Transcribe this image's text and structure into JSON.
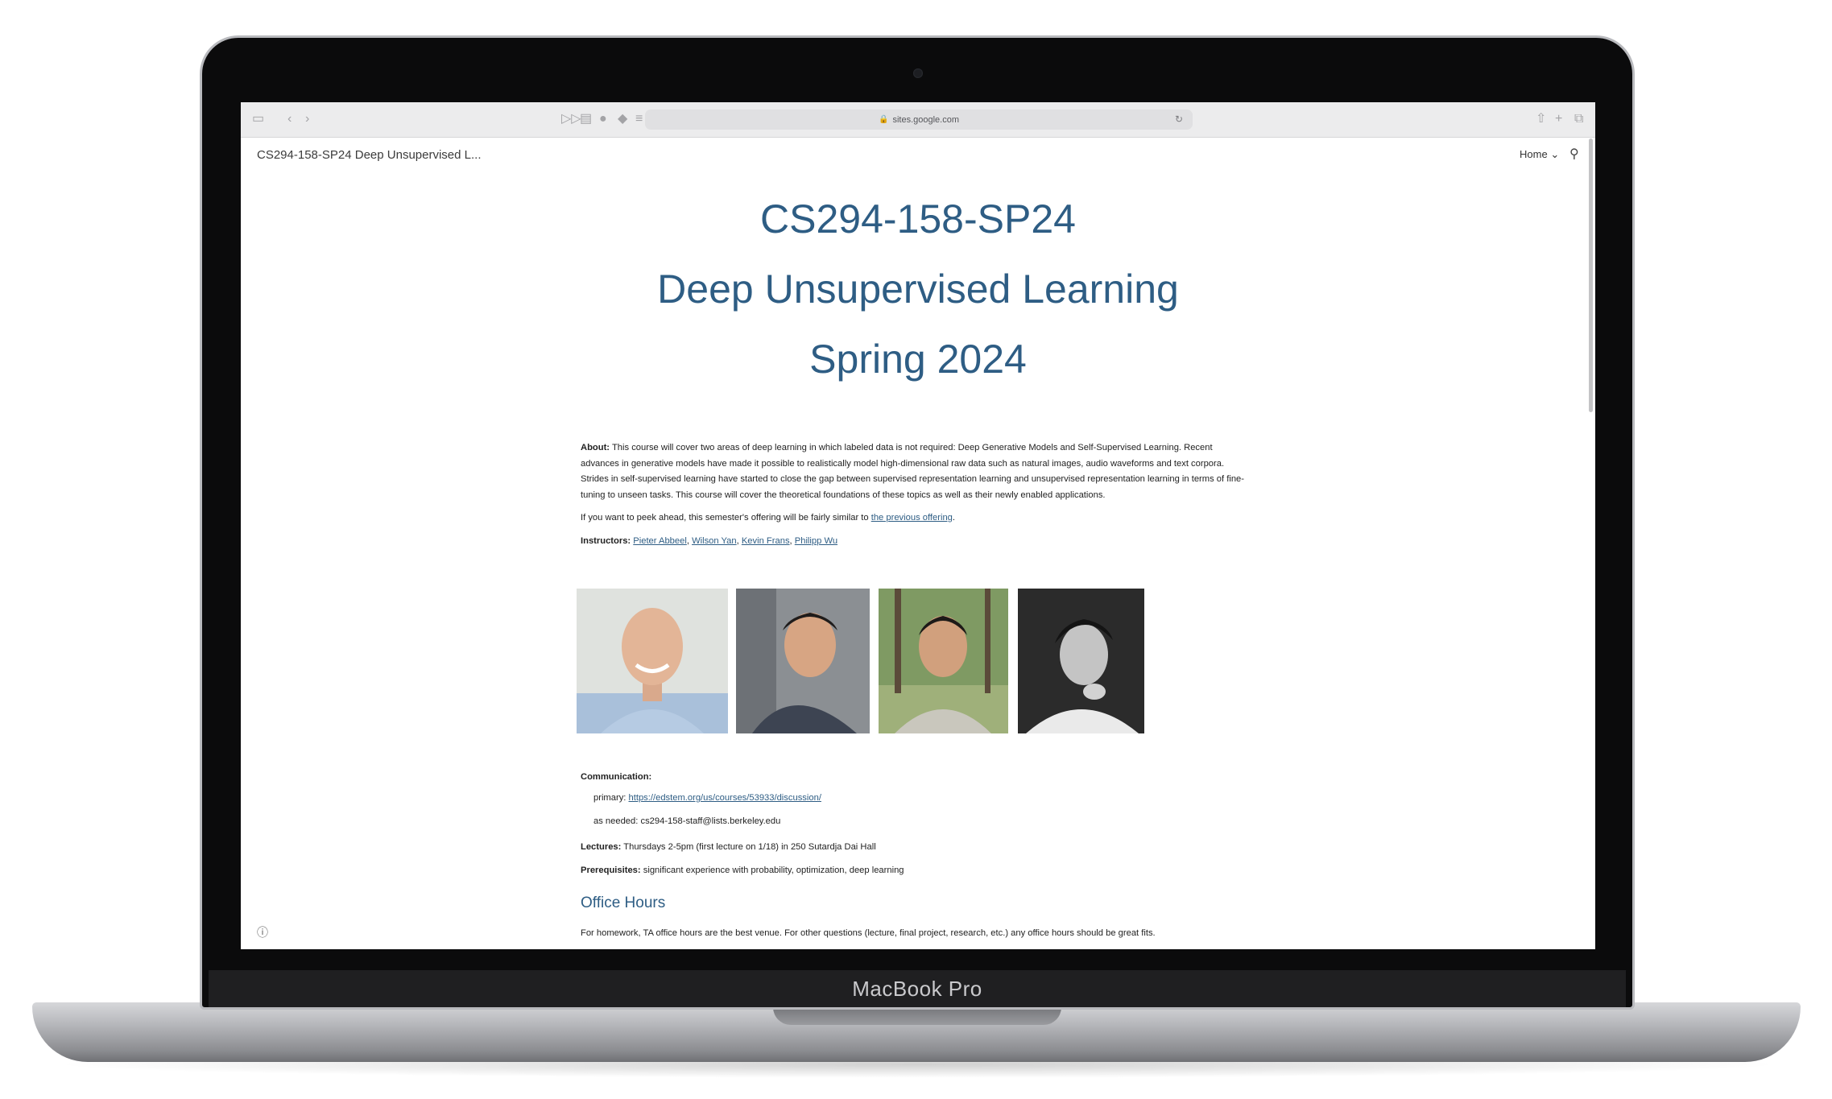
{
  "device": {
    "label": "MacBook Pro"
  },
  "browser": {
    "address": "sites.google.com"
  },
  "site": {
    "title": "CS294-158-SP24 Deep Unsupervised L...",
    "nav_home": "Home",
    "nav_home_caret": "⌄"
  },
  "page": {
    "heading1": "CS294-158-SP24",
    "heading2": "Deep Unsupervised Learning",
    "heading3": "Spring 2024",
    "about_label": "About:",
    "about_text": "This course will cover two areas of deep learning in which labeled data is not required: Deep Generative Models and Self-Supervised Learning.  Recent advances in generative models have made it possible to realistically model high-dimensional raw data such as natural images, audio waveforms and text corpora.  Strides in self-supervised learning have started to close the gap between supervised representation learning and unsupervised representation learning in terms of fine-tuning to unseen tasks.  This course will cover the theoretical foundations of these topics as well as their newly enabled applications.",
    "peek_text": "If you want to peek ahead, this semester's offering will be fairly similar to ",
    "peek_link": "the previous offering",
    "peek_end": ".",
    "instructors_label": "Instructors:",
    "instructors": [
      "Pieter Abbeel",
      "Wilson Yan",
      "Kevin Frans",
      "Philipp Wu"
    ],
    "communication_label": "Communication:",
    "primary_label": "primary:",
    "primary_link": "https://edstem.org/us/courses/53933/discussion/",
    "asneeded_text": "as needed: cs294-158-staff@lists.berkeley.edu",
    "lectures_label": "Lectures:",
    "lectures_text": "Thursdays 2-5pm (first lecture on 1/18) in 250 Sutardja Dai Hall",
    "prereq_label": "Prerequisites:",
    "prereq_text": "significant experience with probability, optimization, deep learning",
    "office_hours_heading": "Office Hours",
    "office_hours_text": "For homework, TA office hours are the best venue.  For other questions (lecture, final project, research, etc.) any office hours should be great fits."
  }
}
